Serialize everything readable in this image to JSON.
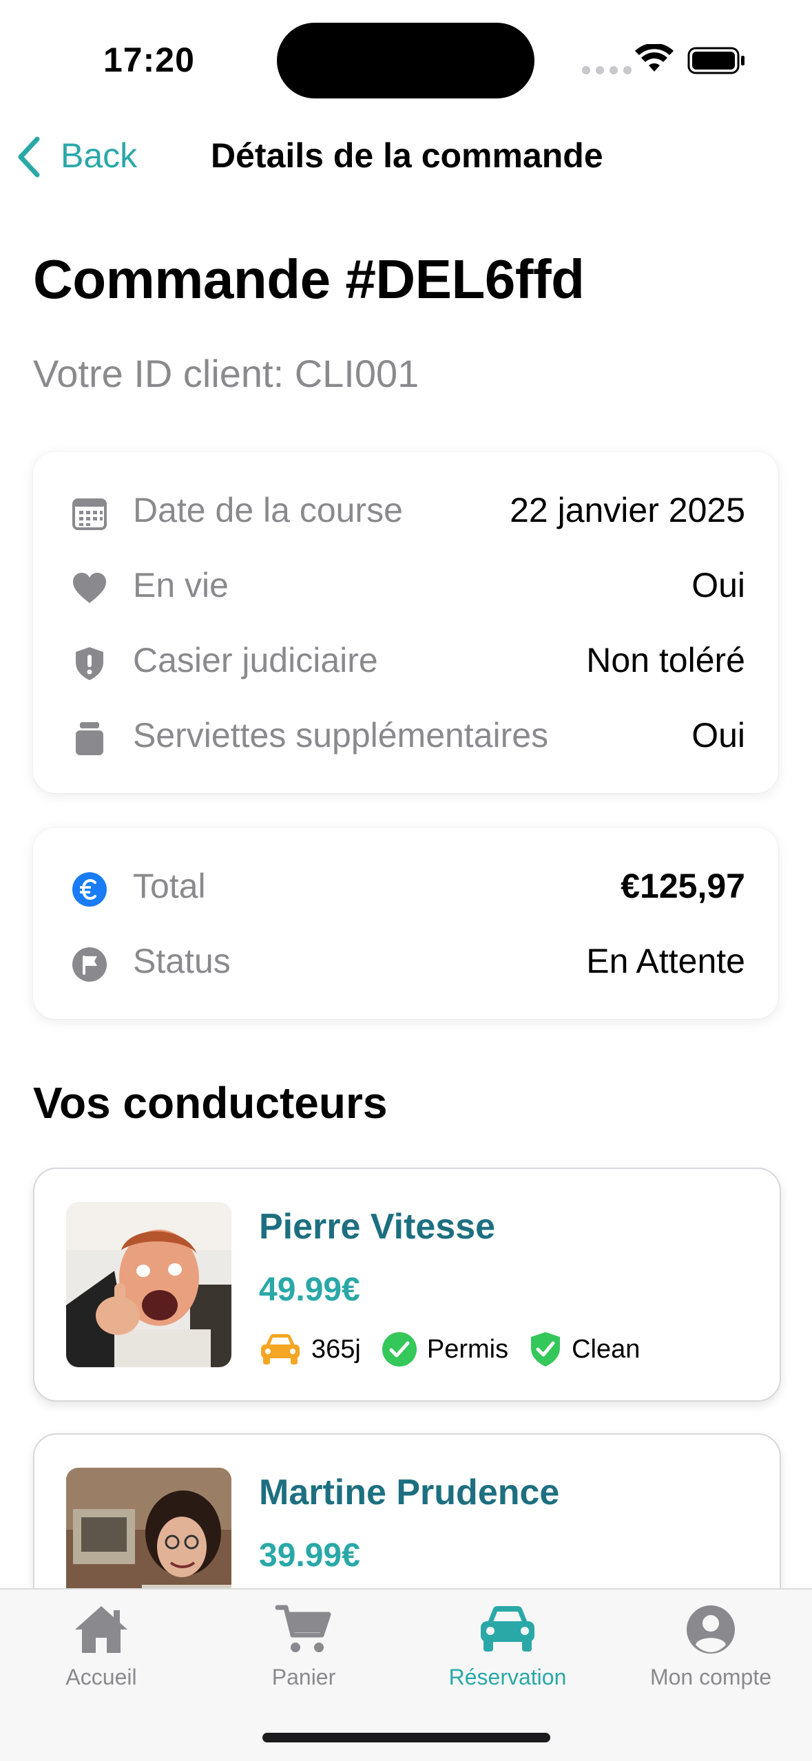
{
  "status_bar": {
    "time": "17:20"
  },
  "nav": {
    "back_label": "Back",
    "title": "Détails de la commande"
  },
  "order": {
    "title": "Commande #DEL6ffd",
    "client_id": "Votre ID client: CLI001"
  },
  "details": [
    {
      "icon": "calendar-icon",
      "label": "Date de la course",
      "value": "22 janvier 2025"
    },
    {
      "icon": "heart-icon",
      "label": "En vie",
      "value": "Oui"
    },
    {
      "icon": "shield-icon",
      "label": "Casier judiciaire",
      "value": "Non toléré"
    },
    {
      "icon": "towel-icon",
      "label": "Serviettes supplémentaires",
      "value": "Oui"
    }
  ],
  "summary": [
    {
      "icon": "euro-icon",
      "label": "Total",
      "value": "€125,97"
    },
    {
      "icon": "flag-icon",
      "label": "Status",
      "value": "En Attente"
    }
  ],
  "drivers_section": {
    "title": "Vos conducteurs"
  },
  "drivers": [
    {
      "name": "Pierre Vitesse",
      "price": "49.99€",
      "badges": [
        {
          "icon": "car-icon",
          "text": "365j"
        },
        {
          "icon": "check-circle-icon",
          "text": "Permis"
        },
        {
          "icon": "check-shield-icon",
          "text": "Clean"
        }
      ]
    },
    {
      "name": "Martine Prudence",
      "price": "39.99€"
    }
  ],
  "tabs": [
    {
      "icon": "home-icon",
      "label": "Accueil",
      "active": false
    },
    {
      "icon": "cart-icon",
      "label": "Panier",
      "active": false
    },
    {
      "icon": "car-icon",
      "label": "Réservation",
      "active": true
    },
    {
      "icon": "account-icon",
      "label": "Mon compte",
      "active": false
    }
  ],
  "colors": {
    "accent": "#2aa8a8",
    "driver_name": "#1d6f80",
    "secondary_text": "#8a8a8e",
    "euro_blue": "#1a7cf5",
    "badge_green": "#34c759",
    "car_orange": "#f5a623"
  }
}
